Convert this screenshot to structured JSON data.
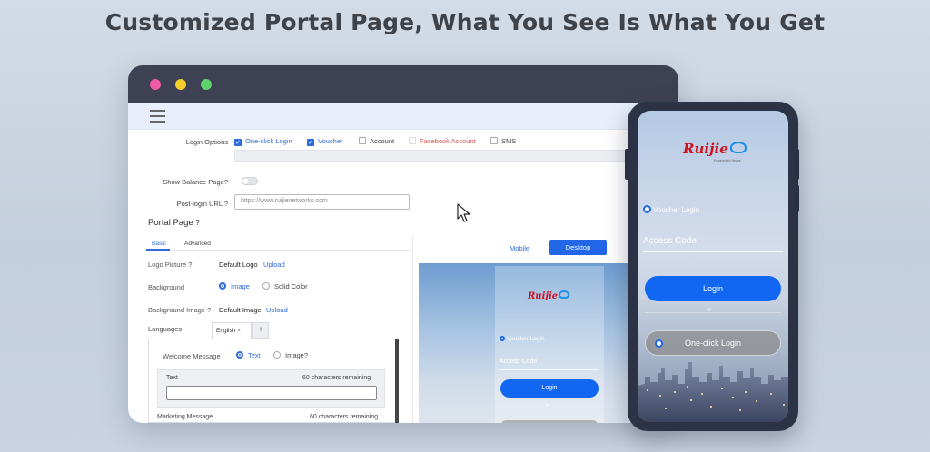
{
  "headline": "Customized Portal Page, What You See Is What You Get",
  "form": {
    "login_options_label": "Login Options",
    "login_options": [
      {
        "label": "One-click Login",
        "checked": true
      },
      {
        "label": "Voucher",
        "checked": true
      },
      {
        "label": "Account",
        "checked": false
      },
      {
        "label": "Facebook Account",
        "checked": false
      },
      {
        "label": "SMS",
        "checked": false
      }
    ],
    "show_balance_label": "Show Balance Page",
    "post_login_label": "Post-login URL",
    "post_login_placeholder": "https://www.ruijienetworks.com",
    "help_icon": "?"
  },
  "portal": {
    "title": "Portal Page",
    "tabs": [
      "Basic",
      "Advanced"
    ],
    "logo_label": "Logo Picture",
    "logo_value": "Default Logo",
    "upload": "Upload",
    "background_label": "Background",
    "background_options": [
      "Image",
      "Solid Color"
    ],
    "background_image_label": "Background Image",
    "background_image_value": "Default Image",
    "languages_label": "Languages",
    "language_tab": "English",
    "close_glyph": "×",
    "add_glyph": "+",
    "welcome_label": "Welcome Message",
    "welcome_options": [
      "Text",
      "Image"
    ],
    "text_label": "Text",
    "text_remaining": "60",
    "remaining_suffix": "characters remaining",
    "marketing_label": "Marketing Message",
    "marketing_remaining": "60"
  },
  "preview": {
    "mode_options": [
      "Mobile",
      "Desktop"
    ],
    "active_mode": "Desktop",
    "brand": "Ruijie",
    "voucher_login": "Voucher Login",
    "access_code": "Access Code",
    "login": "Login",
    "or": "or"
  },
  "phone": {
    "brand": "Ruijie",
    "powered_by": "Powered by Reyee",
    "voucher_login": "Voucher Login",
    "access_code": "Access Code",
    "login": "Login",
    "or": "or",
    "one_click_login": "One-click Login"
  },
  "colors": {
    "accent": "#2266e8",
    "brand_red": "#d0111e",
    "dark_frame": "#3e4153"
  }
}
